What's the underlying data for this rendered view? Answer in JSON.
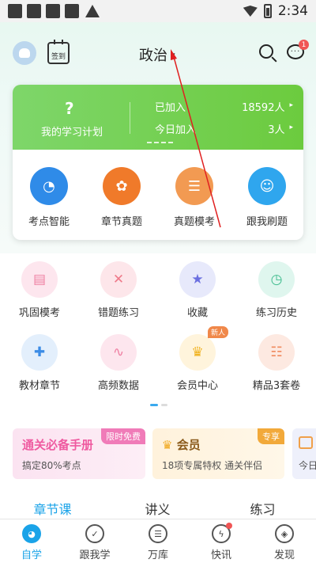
{
  "status_bar": {
    "time": "2:34"
  },
  "header": {
    "signin_label": "签到",
    "subject": "政治",
    "caret": "▾",
    "message_badge": "1",
    "message_glyph": "···"
  },
  "plan_card": {
    "plan_icon": "?",
    "plan_label": "我的学习计划",
    "joined_label": "已加入",
    "joined_value": "18592人",
    "today_label": "今日加入",
    "today_value": "3人",
    "arrow": "▸",
    "accent": "#6ccb3e",
    "items": [
      {
        "label": "考点智能",
        "icon": "clock-icon",
        "glyph": "◔",
        "color": "#2f8be8"
      },
      {
        "label": "章节真题",
        "icon": "gear-icon",
        "glyph": "✿",
        "color": "#f07a2a"
      },
      {
        "label": "真题模考",
        "icon": "document-icon",
        "glyph": "☰",
        "color": "#f29a52"
      },
      {
        "label": "跟我刷题",
        "icon": "chat-icon",
        "glyph": "☺",
        "color": "#2fa6ee"
      }
    ]
  },
  "grid": [
    {
      "label": "巩固模考",
      "icon": "book-icon",
      "glyph": "▤",
      "bg": "#fde6ee",
      "fg": "#ee7fa2"
    },
    {
      "label": "错题练习",
      "icon": "wrong-icon",
      "glyph": "✕",
      "bg": "#fde6ea",
      "fg": "#ef7a8a"
    },
    {
      "label": "收藏",
      "icon": "star-icon",
      "glyph": "★",
      "bg": "#e7e9fb",
      "fg": "#6b6fe0"
    },
    {
      "label": "练习历史",
      "icon": "history-icon",
      "glyph": "◷",
      "bg": "#dff6ee",
      "fg": "#3dbb8c"
    },
    {
      "label": "教材章节",
      "icon": "shield-icon",
      "glyph": "✚",
      "bg": "#e3effc",
      "fg": "#3c8ce6"
    },
    {
      "label": "高频数据",
      "icon": "chart-icon",
      "glyph": "∿",
      "bg": "#fde6ee",
      "fg": "#ee7fa2"
    },
    {
      "label": "会员中心",
      "icon": "crown-icon",
      "glyph": "♛",
      "bg": "#fff4dc",
      "fg": "#f0b21f",
      "badge": "新人"
    },
    {
      "label": "精品3套卷",
      "icon": "paper-icon",
      "glyph": "☷",
      "bg": "#fde9e1",
      "fg": "#f08a5e"
    }
  ],
  "promos": [
    {
      "title": "通关必备手册",
      "sub": "搞定80%考点",
      "tag": "限时免费",
      "title_color": "#ef5aa0",
      "tag_color": "#f07bb8"
    },
    {
      "title": "会员",
      "sub": "18项专属特权  通关伴侣",
      "tag": "专享",
      "title_color": "#8a5a1a",
      "tag_color": "#f2a93a"
    },
    {
      "title": "",
      "sub": "今日",
      "tag": ""
    }
  ],
  "segments": [
    "章节课",
    "讲义",
    "练习"
  ],
  "bottom_nav": [
    {
      "label": "自学",
      "icon": "self-study-icon",
      "glyph": "◕",
      "active": true
    },
    {
      "label": "跟我学",
      "icon": "check-circle-icon",
      "glyph": "✓",
      "active": false
    },
    {
      "label": "万库",
      "icon": "library-icon",
      "glyph": "☰",
      "active": false
    },
    {
      "label": "快讯",
      "icon": "lightning-icon",
      "glyph": "ϟ",
      "active": false,
      "dot": true
    },
    {
      "label": "发现",
      "icon": "compass-icon",
      "glyph": "◈",
      "active": false
    }
  ]
}
